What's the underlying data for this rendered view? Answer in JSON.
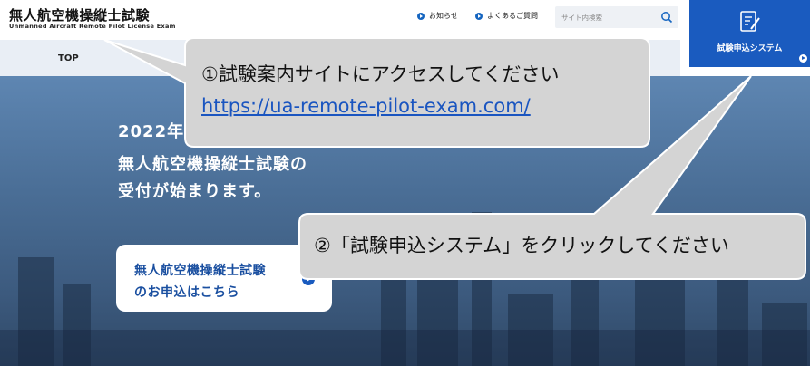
{
  "header": {
    "logo_title": "無人航空機操縦士試験",
    "logo_subtitle": "Unmanned Aircraft Remote Pilot License Exam",
    "links": [
      {
        "label": "お知らせ"
      },
      {
        "label": "よくあるご質問"
      }
    ],
    "search": {
      "placeholder": "サイト内検索"
    },
    "apply_button": {
      "label": "試験申込システム"
    }
  },
  "nav": {
    "items": [
      {
        "label": "TOP"
      }
    ]
  },
  "hero": {
    "lines": [
      "2022年",
      "無人航空機操縦士試験の",
      "受付が始まります。"
    ],
    "cta": {
      "line1": "無人航空機操縦士試験",
      "line2": "のお申込はこちら"
    }
  },
  "callouts": {
    "step1_text": "①試験案内サイトにアクセスしてください",
    "step1_link": "https://ua-remote-pilot-exam.com/",
    "step2_text": "②「試験申込システム」をクリックしてください"
  },
  "colors": {
    "brand_blue": "#1a5bbf",
    "callout_bg": "#d4d4d4"
  }
}
